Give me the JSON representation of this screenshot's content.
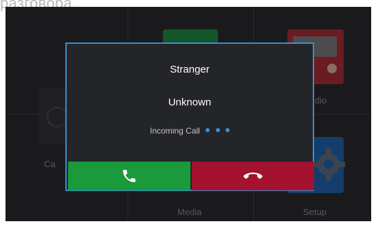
{
  "caption": "разговора.",
  "background": {
    "tiles": [
      {
        "label": "Media"
      },
      {
        "label": "Setup"
      },
      {
        "label": "dio"
      },
      {
        "label": "Ca"
      }
    ]
  },
  "dialog": {
    "title": "Stranger",
    "subtitle": "Unknown",
    "status": "Incoming Call",
    "accent_color": "#3a8fd0",
    "accept_color": "#1a9a3b",
    "decline_color": "#a3122e",
    "accept_icon": "phone-icon",
    "decline_icon": "hang-up-icon"
  }
}
